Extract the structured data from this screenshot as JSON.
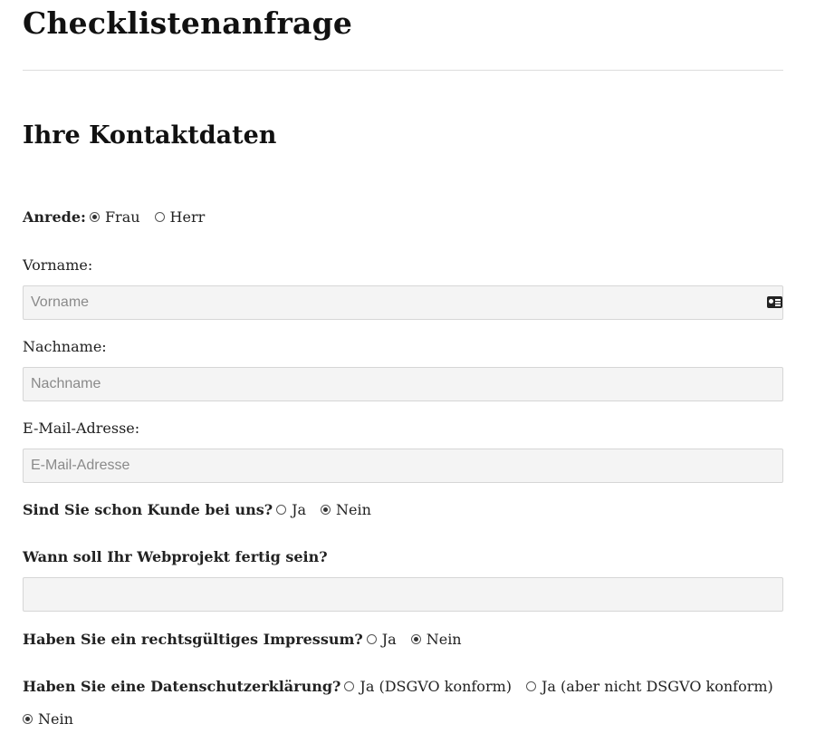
{
  "page": {
    "title": "Checklistenanfrage",
    "section_title": "Ihre Kontaktdaten"
  },
  "anrede": {
    "label": "Anrede:",
    "options": [
      {
        "label": "Frau",
        "checked": true
      },
      {
        "label": "Herr",
        "checked": false
      }
    ]
  },
  "vorname": {
    "label": "Vorname:",
    "placeholder": "Vorname",
    "value": "",
    "icon": "contact-card-icon"
  },
  "nachname": {
    "label": "Nachname:",
    "placeholder": "Nachname",
    "value": ""
  },
  "email": {
    "label": "E-Mail-Adresse:",
    "placeholder": "E-Mail-Adresse",
    "value": ""
  },
  "kunde": {
    "label": "Sind Sie schon Kunde bei uns?",
    "options": [
      {
        "label": "Ja",
        "checked": false
      },
      {
        "label": "Nein",
        "checked": true
      }
    ]
  },
  "fertig": {
    "label": "Wann soll Ihr Webprojekt fertig sein?",
    "placeholder": "",
    "value": ""
  },
  "impressum": {
    "label": "Haben Sie ein rechtsgültiges Impressum?",
    "options": [
      {
        "label": "Ja",
        "checked": false
      },
      {
        "label": "Nein",
        "checked": true
      }
    ]
  },
  "datenschutz": {
    "label": "Haben Sie eine Datenschutzerklärung?",
    "options": [
      {
        "label": "Ja (DSGVO konform)",
        "checked": false
      },
      {
        "label": "Ja (aber nicht DSGVO konform)",
        "checked": false
      },
      {
        "label": "Nein",
        "checked": true
      }
    ]
  }
}
